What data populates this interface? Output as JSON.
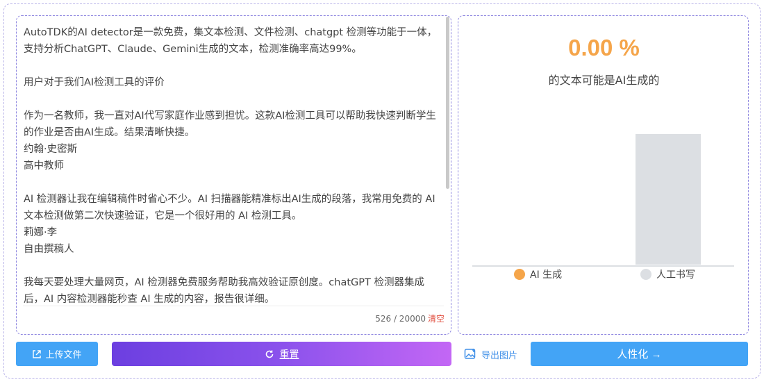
{
  "text_input": {
    "paragraphs": [
      "AutoTDK的AI detector是一款免费，集文本检测、文件检测、chatgpt 检测等功能于一体，支持分析ChatGPT、Claude、Gemini生成的文本，检测准确率高达99%。",
      "用户对于我们AI检测工具的评价",
      "作为一名教师，我一直对AI代写家庭作业感到担忧。这款AI检测工具可以帮助我快速判断学生的作业是否由AI生成。结果清晰快捷。\n约翰·史密斯\n高中教师",
      "AI 检测器让我在编辑稿件时省心不少。AI 扫描器能精准标出AI生成的段落，我常用免费的 AI 文本检测做第二次快速验证，它是一个很好用的 AI 检测工具。\n莉娜·李\n自由撰稿人",
      "我每天要处理大量网页，AI 检测器免费服务帮助我高效验证原创度。chatGPT 检测器集成后，AI 内容检测器能秒查 AI 生成的内容，报告很详细。"
    ],
    "char_count": "526 / 20000",
    "clear_label": "清空"
  },
  "result": {
    "percent": "0.00 %",
    "caption": "的文本可能是AI生成的"
  },
  "chart_data": {
    "type": "bar",
    "categories": [
      "AI 生成",
      "人工书写"
    ],
    "values": [
      0,
      100
    ],
    "colors": [
      "#f5a54a",
      "#dcdfe3"
    ],
    "ylim": [
      0,
      100
    ],
    "legend": "bottom"
  },
  "actions": {
    "upload_label": "上传文件",
    "reset_label": "重置",
    "export_label": "导出图片",
    "humanize_label": "人性化 →"
  }
}
